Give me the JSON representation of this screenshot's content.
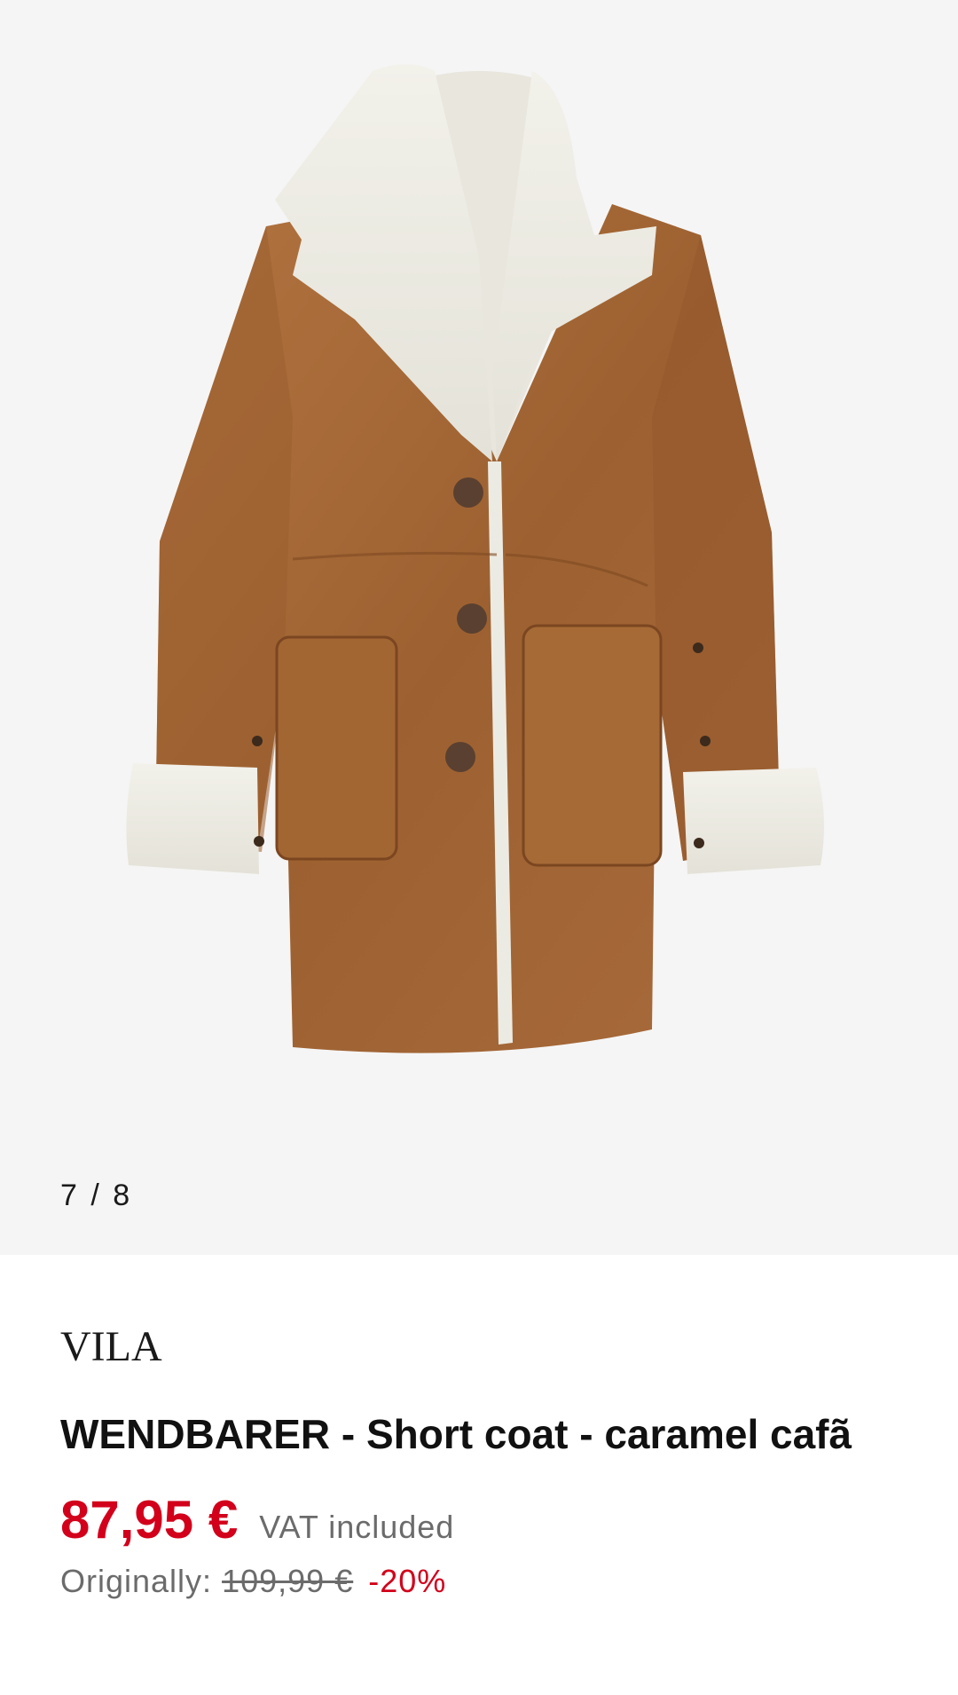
{
  "gallery": {
    "counter": "7 / 8",
    "image_alt": "Caramel faux-shearling short coat with cream teddy collar and cuffs"
  },
  "product": {
    "brand": "VILA",
    "title": "WENDBARER - Short coat - caramel cafã",
    "price": "87,95 €",
    "vat_note": "VAT included",
    "original_label": "Originally:",
    "original_price": "109,99 €",
    "discount": "-20%"
  },
  "colors": {
    "sale_red": "#d2001a",
    "coat_tan": "#a86a3a",
    "shearling_cream": "#efeee6",
    "background": "#f5f5f5"
  }
}
